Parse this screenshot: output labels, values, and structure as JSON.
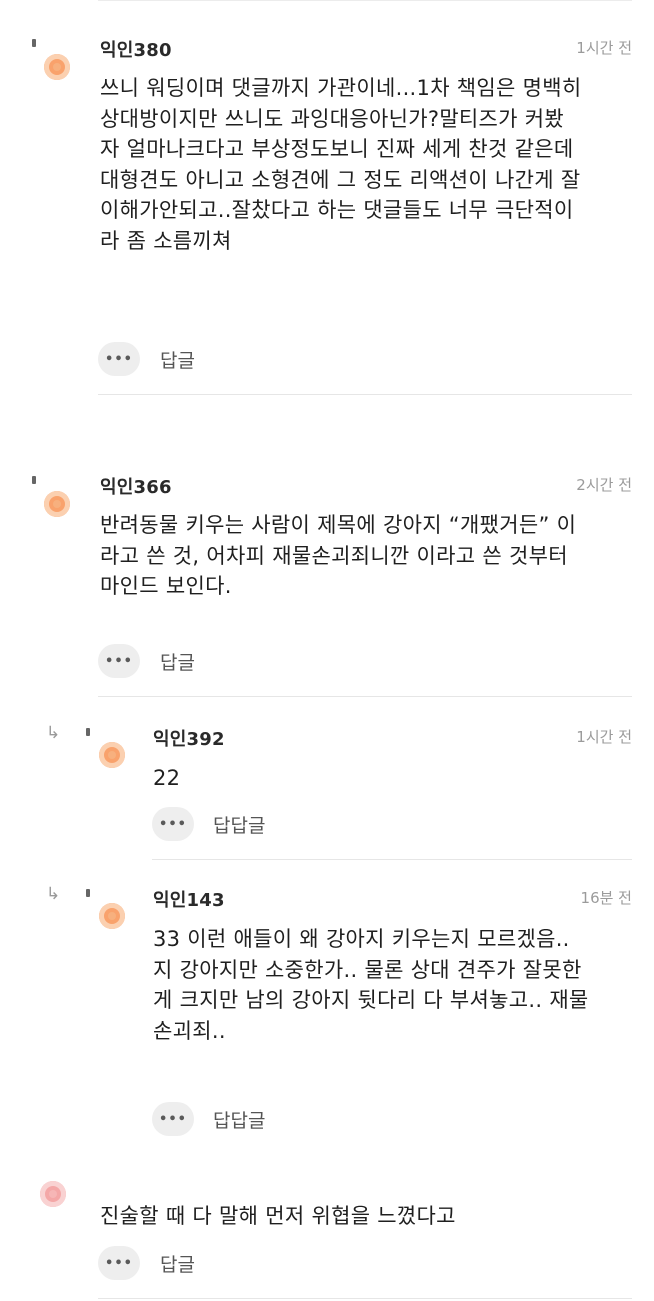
{
  "more_icon": "•••",
  "comments": [
    {
      "name": "익인380",
      "time": "1시간 전",
      "body": "쓰니 워딩이며 댓글까지 가관이네...1차 책임은 명백히\n상대방이지만 쓰니도 과잉대응아닌가?말티즈가 커봤\n자 얼마나크다고 부상정도보니 진짜 세게 찬것 같은데\n대형견도 아니고 소형견에 그 정도 리액션이 나간게 잘\n이해가안되고..잘찼다고 하는 댓글들도 너무 극단적이\n라 좀 소름끼쳐",
      "reply_label": "답글"
    },
    {
      "name": "익인366",
      "time": "2시간 전",
      "body": "반려동물 키우는 사람이 제목에 강아지 “개팼거든” 이\n라고 쓴 것, 어차피 재물손괴죄니깐 이라고 쓴 것부터\n마인드 보인다.",
      "reply_label": "답글"
    },
    {
      "name": "익인392",
      "time": "1시간 전",
      "body": "22",
      "reply_label": "답답글"
    },
    {
      "name": "익인143",
      "time": "16분 전",
      "body": "33 이런 애들이 왜 강아지 키우는지 모르겠음..\n지 강아지만 소중한가.. 물론 상대 견주가 잘못한\n게 크지만 남의 강아지 뒷다리 다 부셔놓고.. 재물\n손괴죄..",
      "reply_label": "답답글"
    },
    {
      "body": "진술할 때 다 말해 먼저 위협을 느꼈다고",
      "reply_label": "답글"
    }
  ]
}
